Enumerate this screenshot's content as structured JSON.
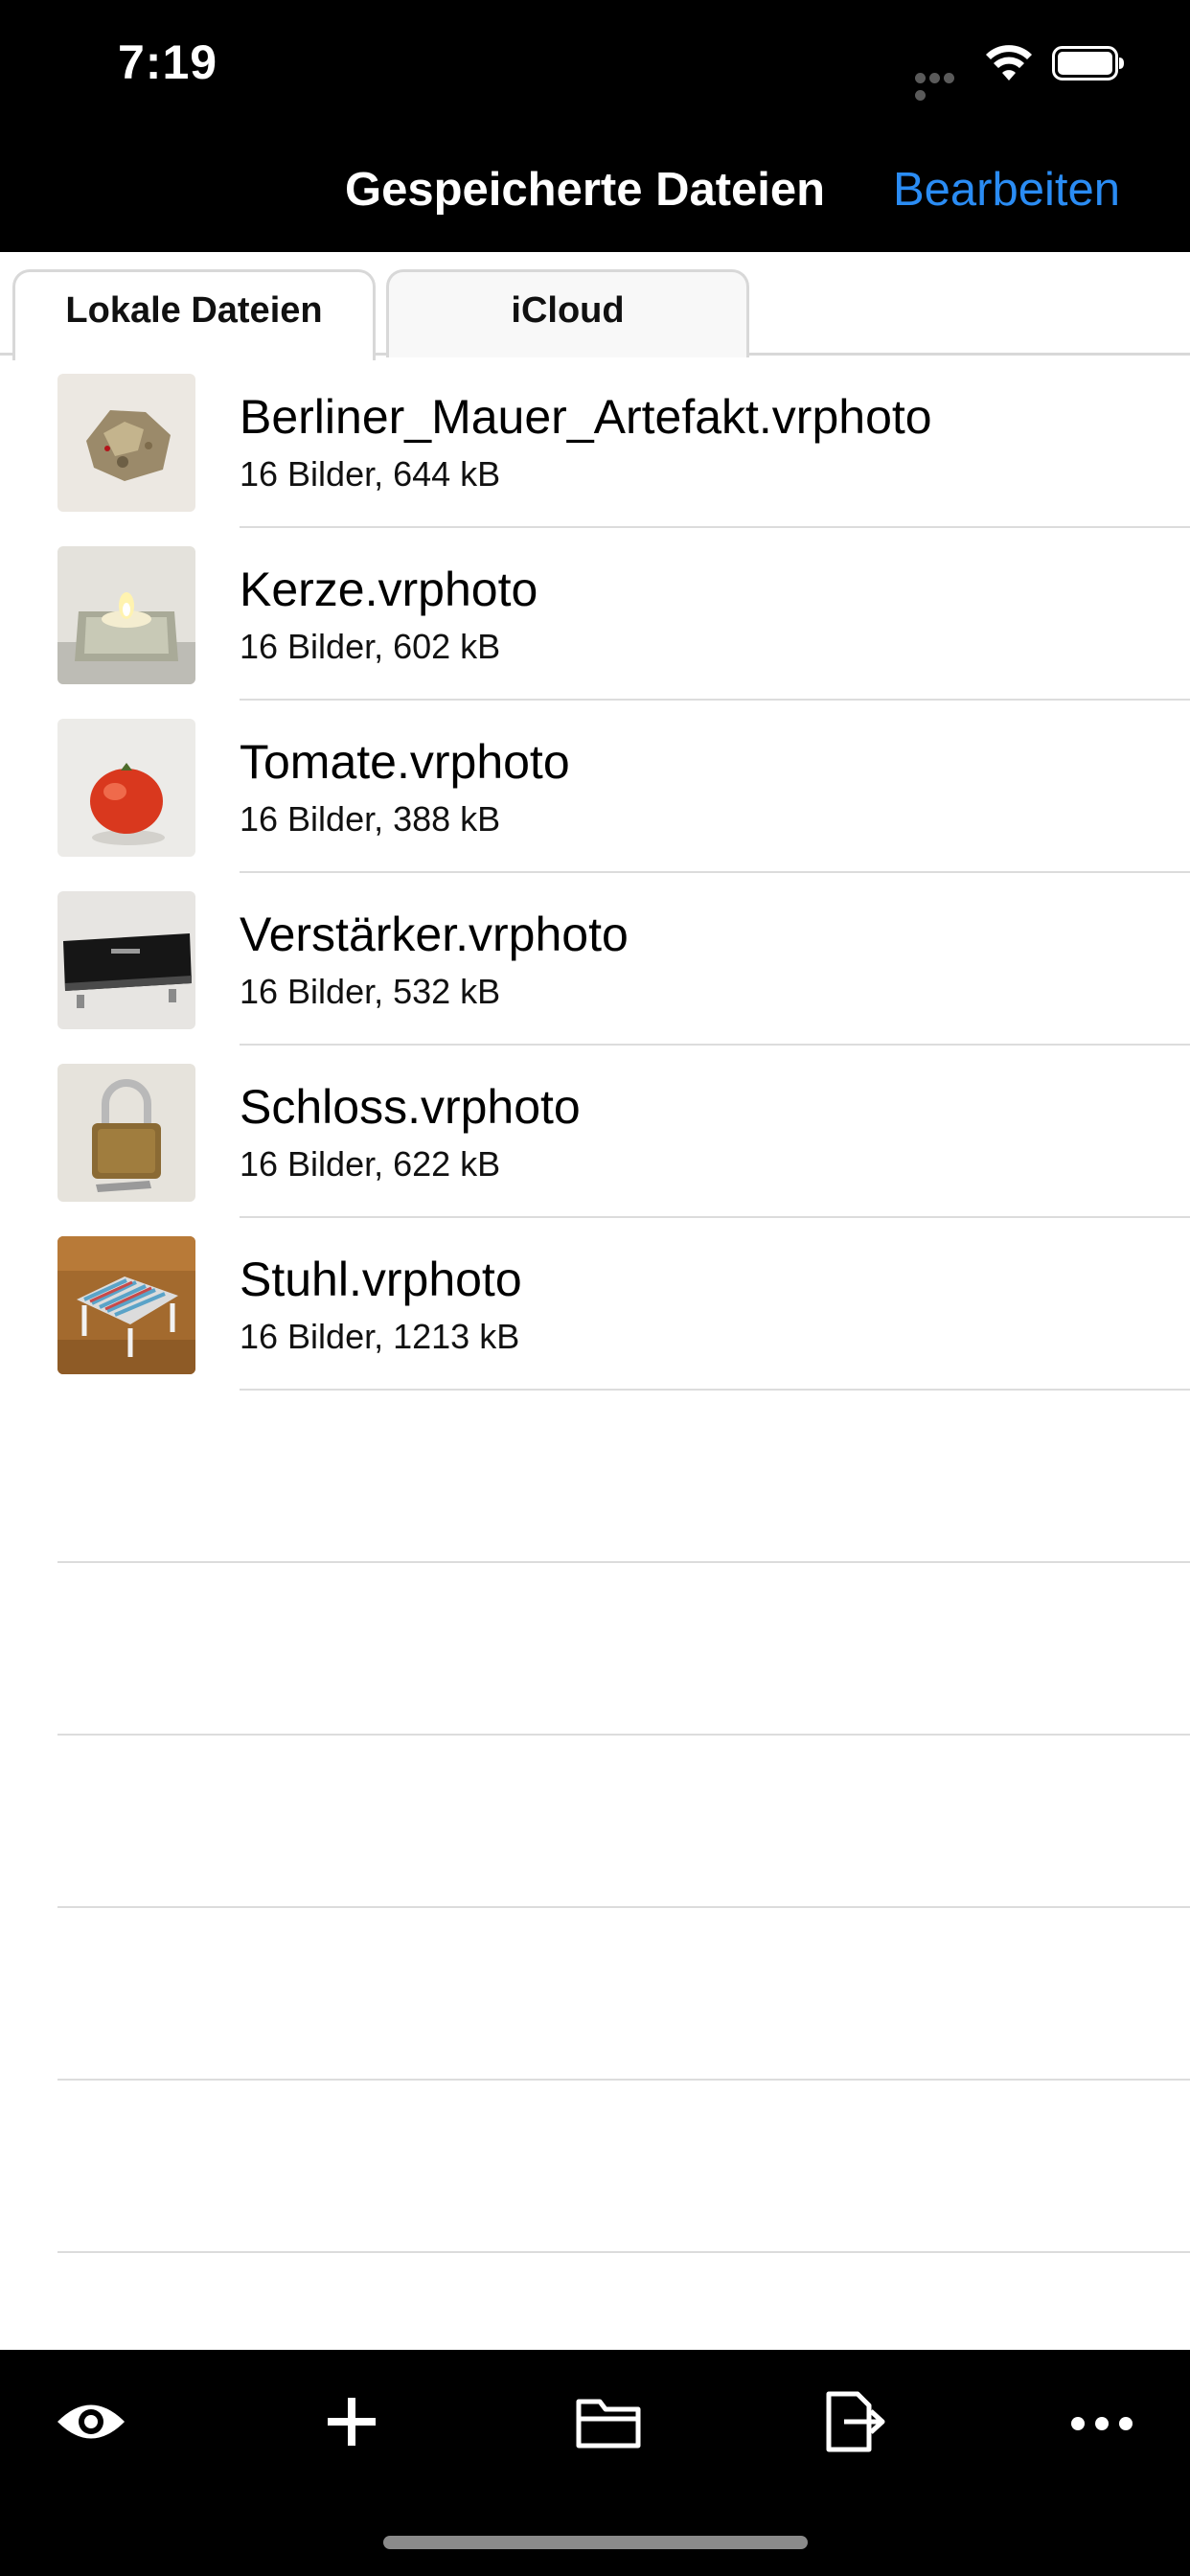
{
  "status_bar": {
    "time": "7:19"
  },
  "nav": {
    "title": "Gespeicherte Dateien",
    "edit_label": "Bearbeiten"
  },
  "tabs": [
    {
      "label": "Lokale Dateien",
      "selected": true
    },
    {
      "label": "iCloud",
      "selected": false
    }
  ],
  "files": [
    {
      "name": "Berliner_Mauer_Artefakt.vrphoto",
      "info": "16 Bilder, 644 kB",
      "thumb": "stone"
    },
    {
      "name": "Kerze.vrphoto",
      "info": "16 Bilder, 602 kB",
      "thumb": "candle"
    },
    {
      "name": "Tomate.vrphoto",
      "info": "16 Bilder, 388 kB",
      "thumb": "tomato"
    },
    {
      "name": "Verstärker.vrphoto",
      "info": "16 Bilder, 532 kB",
      "thumb": "amplifier"
    },
    {
      "name": "Schloss.vrphoto",
      "info": "16 Bilder, 622 kB",
      "thumb": "padlock"
    },
    {
      "name": "Stuhl.vrphoto",
      "info": "16 Bilder, 1213 kB",
      "thumb": "stool"
    }
  ],
  "toolbar": {
    "icons": [
      "eye-icon",
      "plus-icon",
      "folder-icon",
      "export-icon",
      "more-icon"
    ]
  },
  "colors": {
    "accent": "#2a8cf4",
    "bars": "#000000",
    "separator": "#dcdcdc"
  }
}
